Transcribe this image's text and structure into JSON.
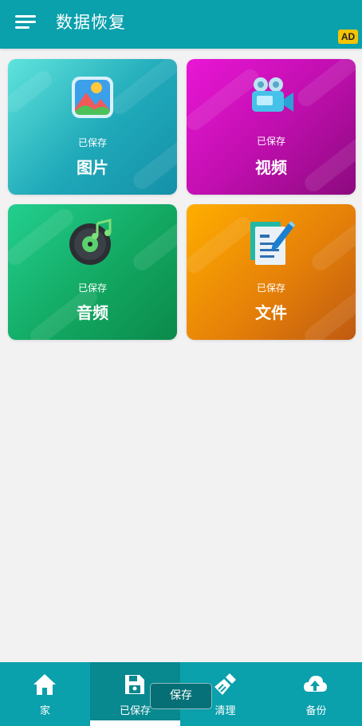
{
  "app": {
    "title": "数据恢复",
    "ad_label": "AD",
    "accent": "#0aa0ac"
  },
  "categories": [
    {
      "id": "photos",
      "subtitle": "已保存",
      "title": "图片",
      "icon": "image-icon",
      "color": "#1fa9b9"
    },
    {
      "id": "videos",
      "subtitle": "已保存",
      "title": "视频",
      "icon": "video-camera-icon",
      "color": "#c10fb0"
    },
    {
      "id": "audio",
      "subtitle": "已保存",
      "title": "音频",
      "icon": "music-disc-icon",
      "color": "#12a862"
    },
    {
      "id": "files",
      "subtitle": "已保存",
      "title": "文件",
      "icon": "document-edit-icon",
      "color": "#e68108"
    }
  ],
  "bottom_nav": {
    "active_index": 1,
    "items": [
      {
        "label": "家",
        "icon": "home-icon"
      },
      {
        "label": "已保存",
        "icon": "save-icon"
      },
      {
        "label": "清理",
        "icon": "broom-icon"
      },
      {
        "label": "备份",
        "icon": "cloud-upload-icon"
      }
    ]
  },
  "toast": {
    "text": "保存"
  }
}
